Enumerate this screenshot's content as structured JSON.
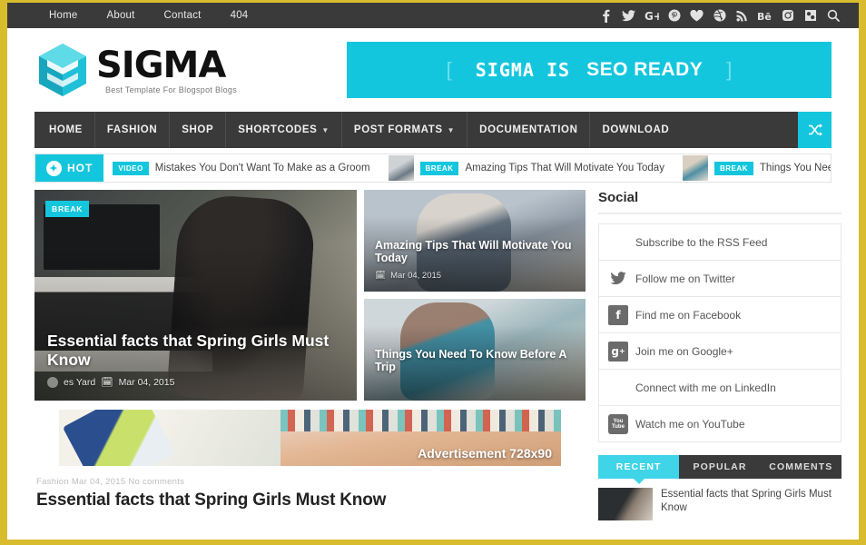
{
  "topbar": {
    "nav": [
      {
        "label": "Home"
      },
      {
        "label": "About"
      },
      {
        "label": "Contact"
      },
      {
        "label": "404"
      }
    ],
    "social_icons": [
      {
        "name": "facebook-icon"
      },
      {
        "name": "twitter-icon"
      },
      {
        "name": "google-plus-icon"
      },
      {
        "name": "pinterest-icon"
      },
      {
        "name": "bloglovin-heart-icon"
      },
      {
        "name": "dribbble-icon"
      },
      {
        "name": "rss-icon"
      },
      {
        "name": "behance-icon"
      },
      {
        "name": "instagram-icon"
      },
      {
        "name": "flickr-icon"
      },
      {
        "name": "search-icon"
      }
    ]
  },
  "header": {
    "logo_word": "SIGMA",
    "logo_tagline": "Best Template For Blogspot Blogs",
    "promo": {
      "bracket_left": "[",
      "text_bold": "SIGMA IS",
      "text_regular": "SEO READY",
      "bracket_right": "]",
      "color": "#14c6dd"
    }
  },
  "mainnav": {
    "items": [
      {
        "label": "HOME",
        "caret": false
      },
      {
        "label": "FASHION",
        "caret": false
      },
      {
        "label": "SHOP",
        "caret": false
      },
      {
        "label": "SHORTCODES",
        "caret": true
      },
      {
        "label": "POST FORMATS",
        "caret": true
      },
      {
        "label": "DOCUMENTATION",
        "caret": false
      },
      {
        "label": "DOWNLOAD",
        "caret": false
      }
    ],
    "shuffle_glyph": "⤨",
    "accent": "#14c6dd"
  },
  "ticker": {
    "hot_label": "HOT",
    "items": [
      {
        "tag": "VIDEO",
        "title": "Mistakes You Don't Want To Make as a Groom",
        "has_thumb": false
      },
      {
        "tag": "BREAK",
        "title": "Amazing Tips That Will Motivate You Today",
        "has_thumb": true
      },
      {
        "tag": "BREAK",
        "title": "Things You Need To Know Before A",
        "has_thumb": true
      }
    ]
  },
  "featured": {
    "main": {
      "badge": "BREAK",
      "title": "Essential facts that Spring Girls Must Know",
      "author": "es Yard",
      "date": "Mar 04, 2015"
    },
    "secondary": [
      {
        "title": "Amazing Tips That Will Motivate You Today",
        "date": "Mar 04, 2015"
      },
      {
        "title": "Things You Need To Know Before A Trip",
        "date": ""
      }
    ]
  },
  "ad": {
    "label": "Advertisement 728x90"
  },
  "post": {
    "meta": "Fashion  Mar 04, 2015  No comments",
    "title": "Essential facts that Spring Girls Must Know"
  },
  "sidebar": {
    "social_widget": {
      "title": "Social",
      "items": [
        {
          "icon": "rss-icon",
          "label": "Subscribe to the RSS Feed",
          "show_icon": false
        },
        {
          "icon": "twitter-icon",
          "label": "Follow me on Twitter",
          "show_icon": true
        },
        {
          "icon": "facebook-icon",
          "label": "Find me on Facebook",
          "show_icon": true
        },
        {
          "icon": "google-plus-icon",
          "label": "Join me on Google+",
          "show_icon": true
        },
        {
          "icon": "linkedin-icon",
          "label": "Connect with me on LinkedIn",
          "show_icon": false
        },
        {
          "icon": "youtube-icon",
          "label": "Watch me on YouTube",
          "show_icon": true
        }
      ]
    },
    "tabs": [
      {
        "label": "RECENT",
        "active": true
      },
      {
        "label": "POPULAR",
        "active": false
      },
      {
        "label": "COMMENTS",
        "active": false
      }
    ],
    "recent": [
      {
        "title": "Essential facts that Spring Girls Must Know"
      }
    ]
  }
}
